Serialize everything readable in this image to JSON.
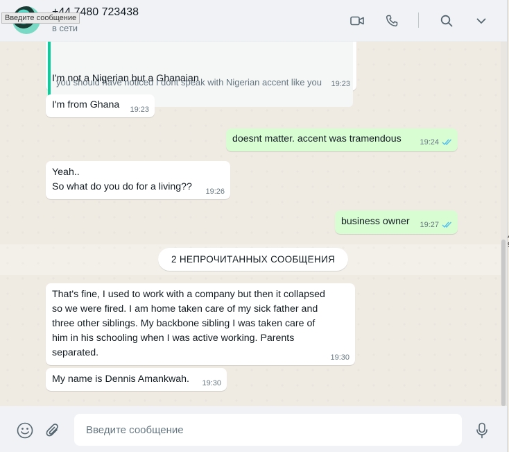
{
  "header": {
    "contact_name": "+44 7480 723438",
    "status": "в сети",
    "tooltip": "Введите сообщение",
    "icons": [
      "video-call-icon",
      "voice-call-icon",
      "search-icon",
      "menu-chevron-icon"
    ]
  },
  "messages": [
    {
      "dir": "in",
      "quoted_text": "you should have noticed I dont speak with Nigerian accent like you",
      "text": "I'm not a Nigerian but a Ghanaian",
      "time": "19:23"
    },
    {
      "dir": "in",
      "text": "I'm from Ghana",
      "time": "19:23"
    },
    {
      "dir": "out",
      "text": "doesnt matter. accent was tramendous",
      "time": "19:24",
      "status": "read"
    },
    {
      "dir": "in",
      "text_lines": [
        "Yeah..",
        "So what do you do for a living??"
      ],
      "time": "19:26"
    },
    {
      "dir": "out",
      "text": "business owner",
      "time": "19:27",
      "status": "read"
    },
    {
      "dir": "in",
      "text_lines": [
        "That's fine, I used to work with a company but then it collapsed",
        "so we were fired. I am home taken care of my sick father and",
        "three other siblings. My backbone sibling I was taken care of",
        "him in his schooling when I was active working. Parents",
        "separated."
      ],
      "time": "19:30"
    },
    {
      "dir": "in",
      "text": "My name is Dennis Amankwah.",
      "time": "19:30"
    }
  ],
  "unread_divider": "2 НЕПРОЧИТАННЫХ СООБЩЕНИЯ",
  "composer": {
    "placeholder": "Введите сообщение",
    "icons": [
      "emoji-icon",
      "attach-icon",
      "microphone-icon"
    ]
  },
  "colors": {
    "incoming_bubble": "#ffffff",
    "outgoing_bubble": "#d9fdd3",
    "read_ticks": "#53bdeb",
    "quote_bar": "#06cf9c",
    "chat_background": "#efeae2",
    "panel": "#f0f2f5"
  },
  "edge_glyphs": [
    "4",
    "9"
  ]
}
